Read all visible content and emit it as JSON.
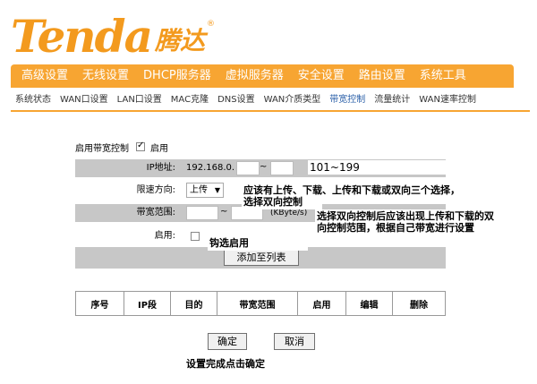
{
  "brand": {
    "logo_en": "Tenda",
    "logo_cn": "腾达",
    "logo_mark": "®"
  },
  "main_nav": [
    "高级设置",
    "无线设置",
    "DHCP服务器",
    "虚拟服务器",
    "安全设置",
    "路由设置",
    "系统工具"
  ],
  "sub_nav": {
    "items": [
      "系统状态",
      "WAN口设置",
      "LAN口设置",
      "MAC克隆",
      "DNS设置",
      "WAN介质类型",
      "带宽控制",
      "流量统计",
      "WAN速率控制"
    ],
    "active_index": 6
  },
  "form": {
    "enable_bw_label": "启用带宽控制",
    "enable_bw_checkbox_label": "启用",
    "enable_bw_checked": true,
    "ip_label": "IP地址:",
    "ip_prefix": "192.168.0.",
    "ip_separator": "~",
    "ip_from": "",
    "ip_to": "",
    "direction_label": "限速方向:",
    "direction_value": "上传",
    "range_label": "带宽范围:",
    "range_separator": "~",
    "range_min": "",
    "range_max": "",
    "range_unit": "(KByte/s)",
    "enable_label": "启用:",
    "enable_checked": false,
    "add_button": "添加至列表"
  },
  "table": {
    "headers": [
      "序号",
      "IP段",
      "目的",
      "带宽范围",
      "启用",
      "编辑",
      "删除"
    ]
  },
  "actions": {
    "confirm": "确定",
    "cancel": "取消"
  },
  "annotations": {
    "ip_range": "101~199",
    "direction_note_1": "应该有上传、下载、上传和下载或双向三个选择，",
    "direction_note_2": "选择双向控制",
    "range_note_1": "选择双向控制后应该出现上传和下载的双",
    "range_note_2": "向控制范围，根据自己带宽进行设置",
    "enable_note": "钩选启用",
    "confirm_note": "设置完成点击确定"
  }
}
